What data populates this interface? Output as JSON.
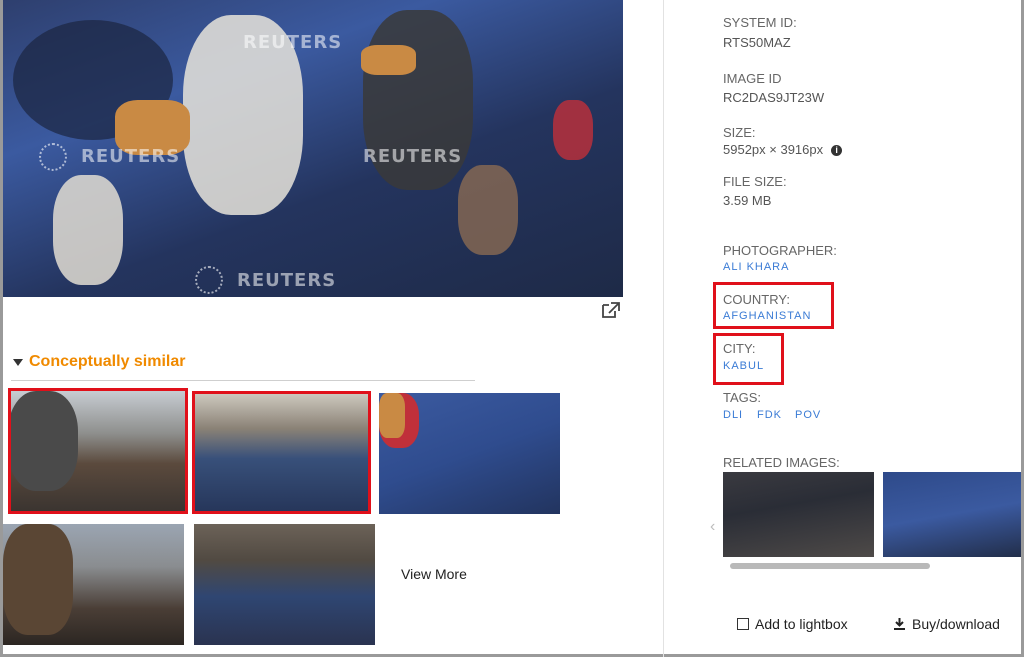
{
  "main_image": {
    "watermarks": [
      "REUTERS",
      "REUTERS",
      "REUTERS",
      "REUTERS"
    ]
  },
  "similar": {
    "title": "Conceptually similar",
    "view_more": "View More"
  },
  "metadata": {
    "system_id_label": "SYSTEM ID:",
    "system_id": "RTS50MAZ",
    "image_id_label": "IMAGE ID",
    "image_id": "RC2DAS9JT23W",
    "size_label": "SIZE:",
    "size": "5952px × 3916px",
    "file_size_label": "FILE SIZE:",
    "file_size": "3.59 MB",
    "photographer_label": "PHOTOGRAPHER:",
    "photographer": "ALI KHARA",
    "country_label": "COUNTRY:",
    "country": "AFGHANISTAN",
    "city_label": "CITY:",
    "city": "KABUL",
    "tags_label": "TAGS:",
    "tags": [
      "DLI",
      "FDK",
      "POV"
    ],
    "related_label": "RELATED IMAGES:"
  },
  "actions": {
    "lightbox": "Add to lightbox",
    "buy": "Buy/download"
  },
  "colors": {
    "accent_orange": "#f08a00",
    "link_blue": "#3a7bd5",
    "highlight_red": "#e0101a"
  },
  "icons": {
    "external_link": "external-link-icon",
    "info": "info-icon",
    "download": "download-icon",
    "checkbox": "checkbox-icon"
  }
}
